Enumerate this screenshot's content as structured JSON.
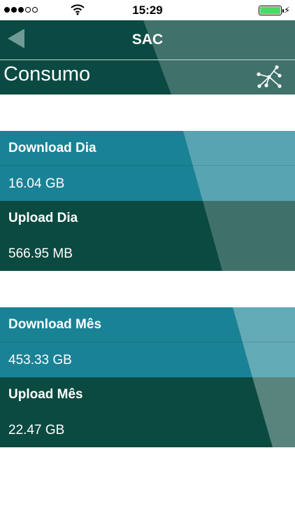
{
  "status_bar": {
    "time": "15:29",
    "signal_bars_filled": 3,
    "signal_bars_total": 5,
    "battery_level": 1.0,
    "charging": true
  },
  "header": {
    "back_icon": "back-arrow-icon",
    "title": "SAC",
    "page_title": "Consumo",
    "network_icon": "network-icon"
  },
  "daily": {
    "download_label": "Download Dia",
    "download_value": "16.04 GB",
    "upload_label": "Upload Dia",
    "upload_value": "566.95 MB"
  },
  "monthly": {
    "download_label": "Download Mês",
    "download_value": "453.33 GB",
    "upload_label": "Upload Mês",
    "upload_value": "22.47 GB"
  },
  "colors": {
    "header": "#0b4a42",
    "download_row": "#1a8295",
    "upload_row": "#0a4a40",
    "battery": "#4cd964"
  }
}
